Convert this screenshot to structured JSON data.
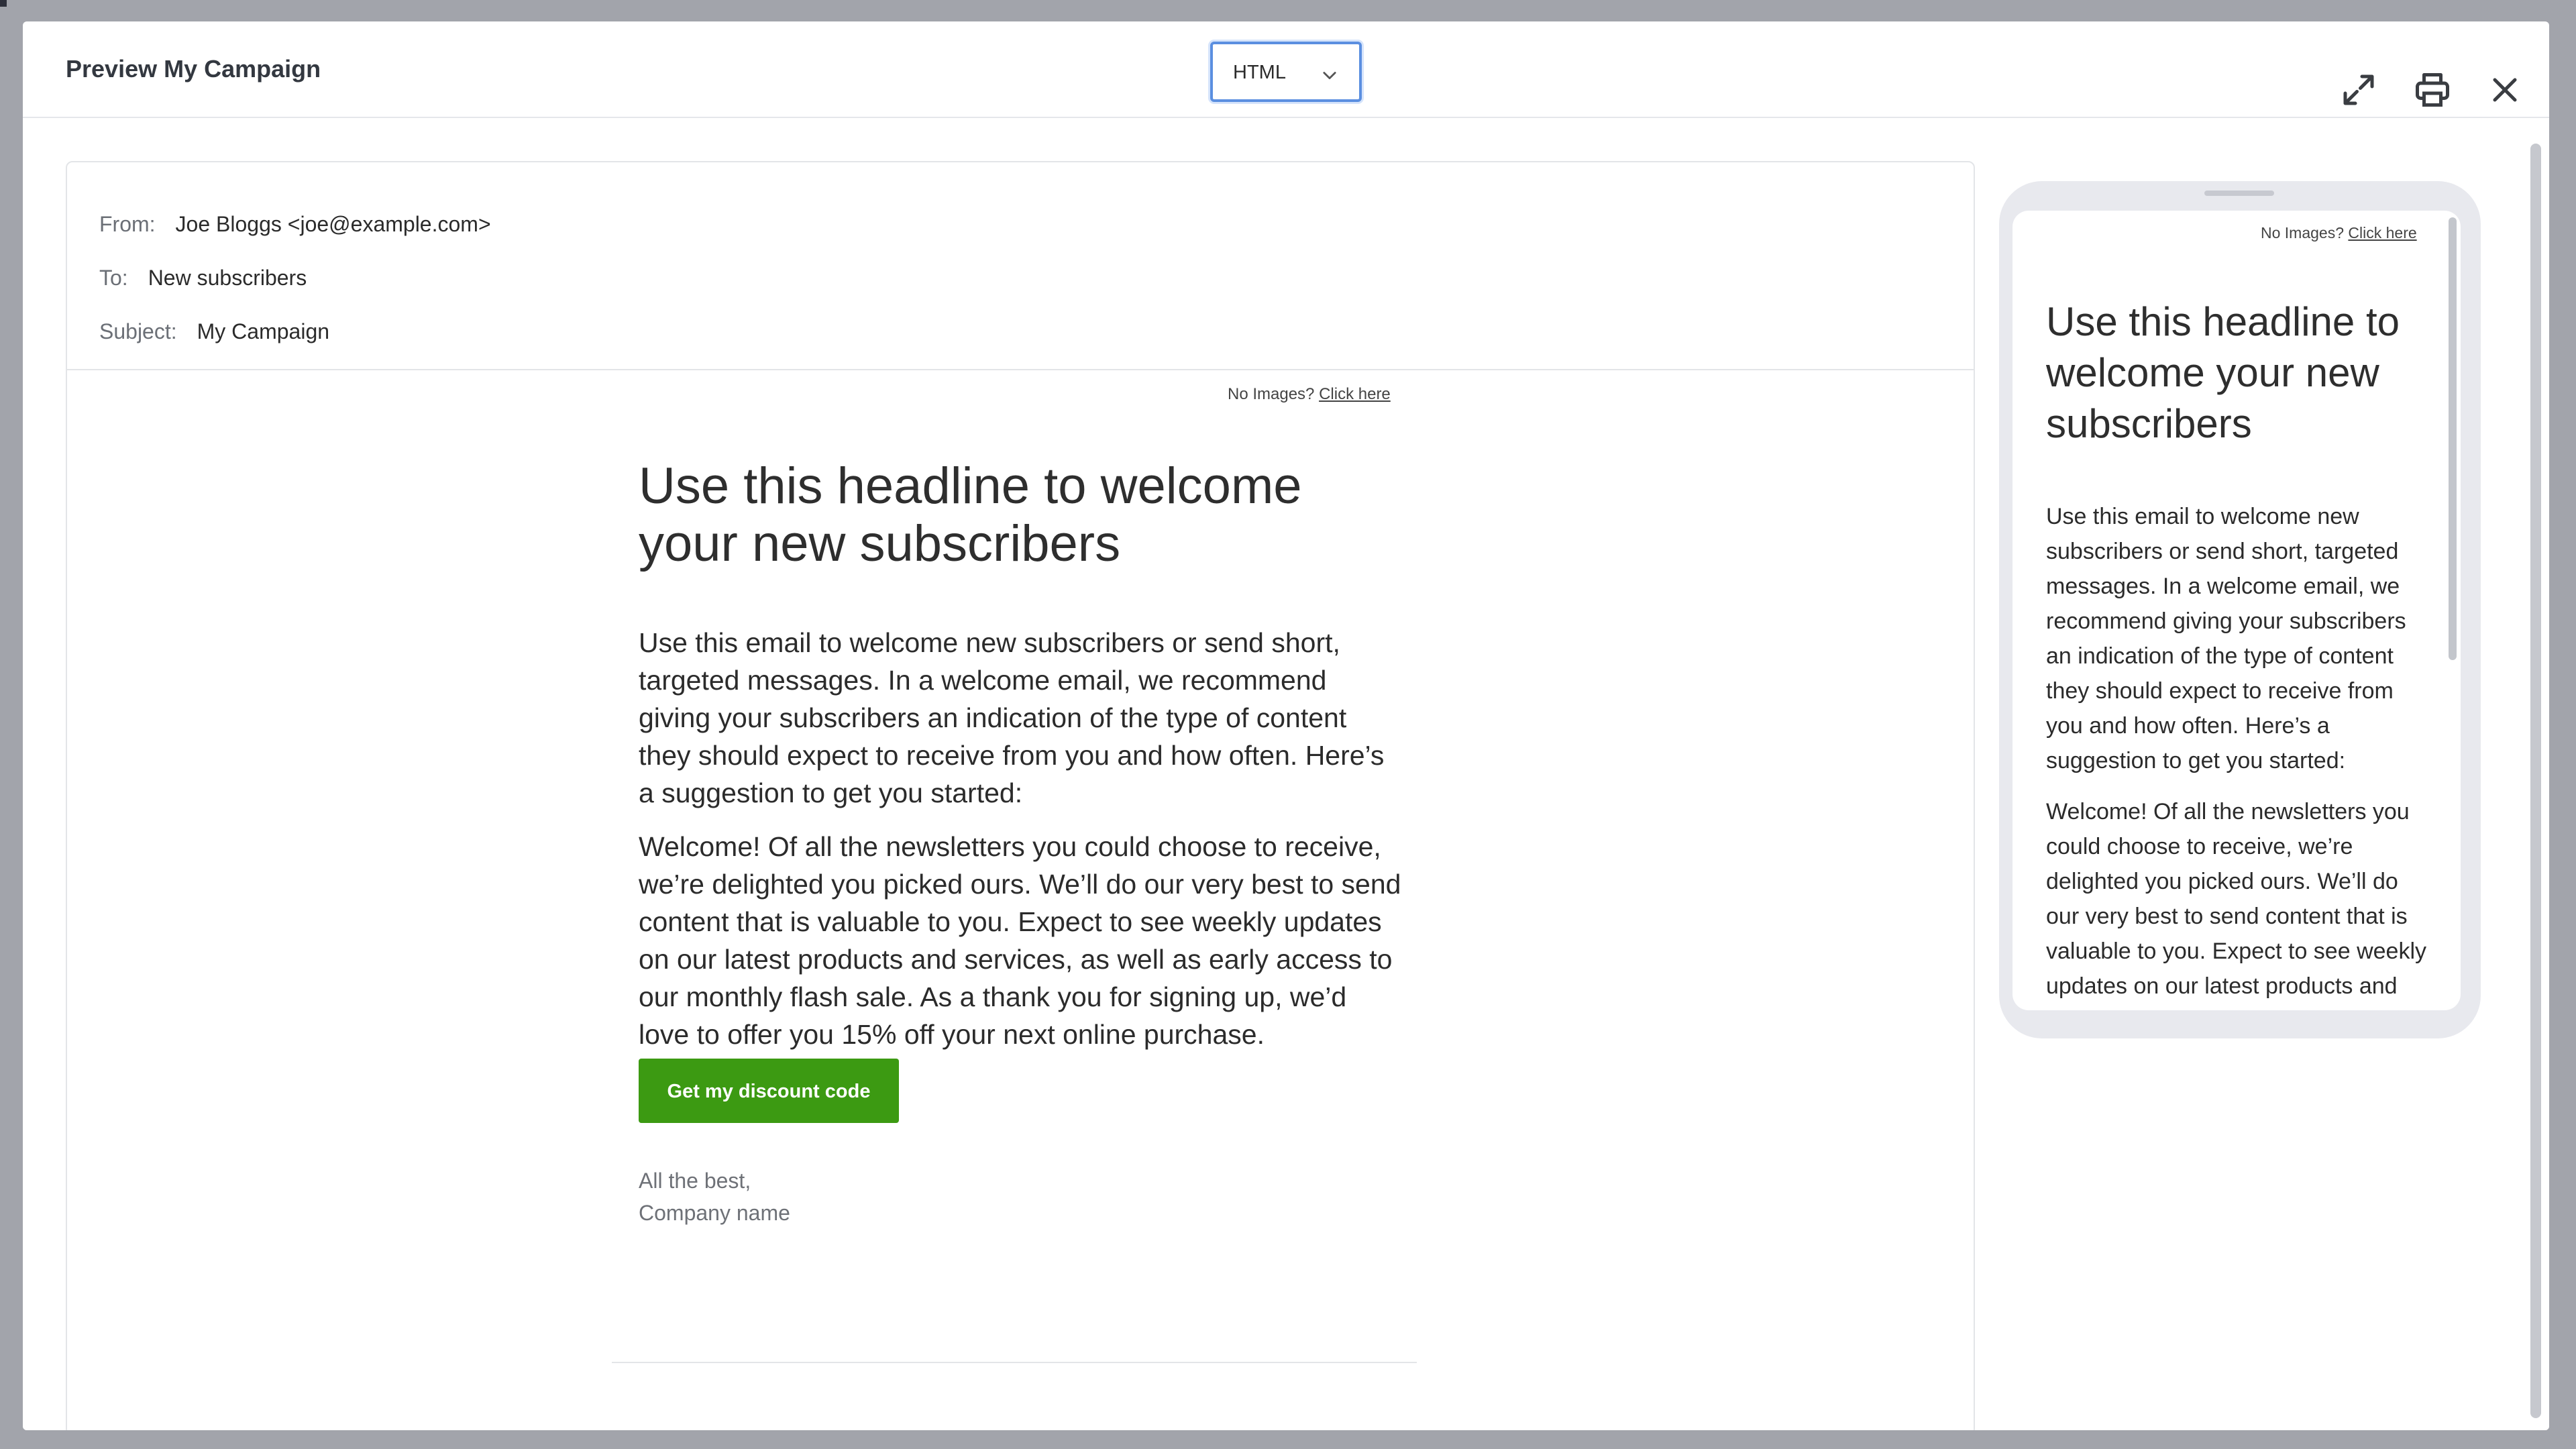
{
  "modal": {
    "title": "Preview My Campaign",
    "format_value": "HTML"
  },
  "header_icons": [
    "expand-icon",
    "print-icon",
    "close-icon"
  ],
  "envelope": {
    "from_label": "From:",
    "from_value": "Joe Bloggs <joe@example.com>",
    "to_label": "To:",
    "to_value": "New subscribers",
    "subject_label": "Subject:",
    "subject_value": "My Campaign"
  },
  "email": {
    "no_images_text": "No Images?",
    "no_images_link": "Click here",
    "headline": "Use this headline to welcome your new subscribers",
    "paragraph1": "Use this email to welcome new subscribers or send short, targeted messages. In a welcome email, we recommend giving your subscribers an indication of the type of content they should expect to receive from you and how often. Here’s a suggestion to get you started:",
    "paragraph2": "Welcome! Of all the newsletters you could choose to receive, we’re delighted you picked ours. We’ll do our very best to send content that is valuable to you. Expect to see weekly updates on our latest products and services, as well as early access to our monthly flash sale. As a thank you for signing up, we’d love to offer you 15% off your next online purchase.",
    "cta_label": "Get my discount code",
    "signoff_line1": "All the best,",
    "signoff_line2": "Company name"
  },
  "colors": {
    "cta": "#3c9a12",
    "focus_ring": "#5b8fe0",
    "backdrop": "#a2a4ab"
  }
}
